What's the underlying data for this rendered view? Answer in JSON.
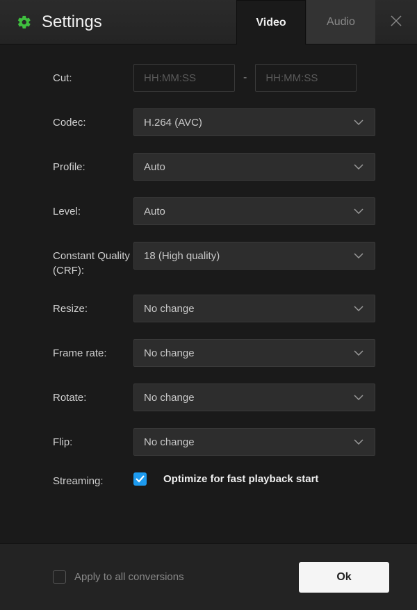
{
  "header": {
    "title": "Settings",
    "tabs": {
      "video": "Video",
      "audio": "Audio"
    }
  },
  "labels": {
    "cut": "Cut:",
    "codec": "Codec:",
    "profile": "Profile:",
    "level": "Level:",
    "crf": "Constant Quality (CRF):",
    "resize": "Resize:",
    "framerate": "Frame rate:",
    "rotate": "Rotate:",
    "flip": "Flip:",
    "streaming": "Streaming:"
  },
  "values": {
    "cut_start_placeholder": "HH:MM:SS",
    "cut_end_placeholder": "HH:MM:SS",
    "dash": "-",
    "codec": "H.264 (AVC)",
    "profile": "Auto",
    "level": "Auto",
    "crf": "18 (High quality)",
    "resize": "No change",
    "framerate": "No change",
    "rotate": "No change",
    "flip": "No change",
    "streaming_label": "Optimize for fast playback start",
    "streaming_checked": true
  },
  "footer": {
    "apply_label": "Apply to all conversions",
    "apply_checked": false,
    "ok": "Ok"
  }
}
